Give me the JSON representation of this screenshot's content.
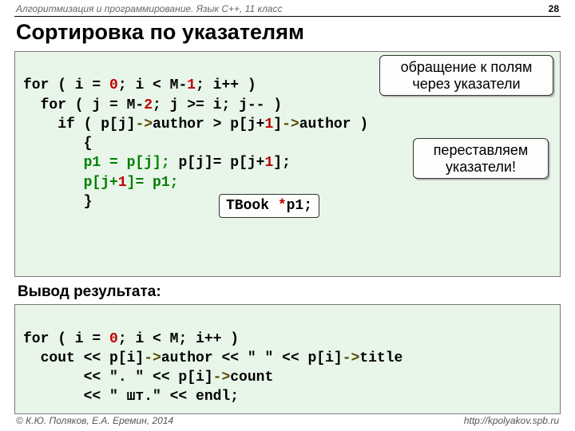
{
  "header": {
    "course": "Алгоритмизация и программирование. Язык C++, 11 класс",
    "page": "28"
  },
  "title": "Сортировка по указателям",
  "callout1_line1": "обращение к полям",
  "callout1_line2": "через указатели",
  "callout2_line1": "переставляем",
  "callout2_line2": "указатели!",
  "code1": {
    "l1a": "for ( i = ",
    "l1b": "0",
    "l1c": "; i < M-",
    "l1d": "1",
    "l1e": "; i++ )",
    "l2a": "  for ( j = M-",
    "l2b": "2",
    "l2c": "; j >= i; j-- )",
    "l3a": "    if ( p[j]",
    "l3arrow1": "->",
    "l3b": "author > p[j+",
    "l3n1": "1",
    "l3c": "]",
    "l3arrow2": "->",
    "l3d": "author )",
    "l4": "       {",
    "l5a": "       ",
    "l5g1": "p1 = p[j];",
    "l5b": " p[j]= p[j+",
    "l5n": "1",
    "l5c": "];",
    "l6a": "       ",
    "l6g": "p[j+",
    "l6n": "1",
    "l6g2": "]= p1;",
    "l7": "       }"
  },
  "tbook_a": "TBook ",
  "tbook_b": "*",
  "tbook_c": "p1;",
  "subtitle": "Вывод результата:",
  "code2": {
    "l1a": "for ( i = ",
    "l1b": "0",
    "l1c": "; i < M; i++ )",
    "l2a": "  cout << p[i]",
    "l2ar1": "->",
    "l2b": "author << \" \" << p[i]",
    "l2ar2": "->",
    "l2c": "title",
    "l3a": "       << \". \" << p[i]",
    "l3ar": "->",
    "l3b": "count",
    "l4": "       << \" шт.\" << endl;"
  },
  "footer": {
    "left": "© К.Ю. Поляков, Е.А. Еремин, 2014",
    "right": "http://kpolyakov.spb.ru"
  }
}
